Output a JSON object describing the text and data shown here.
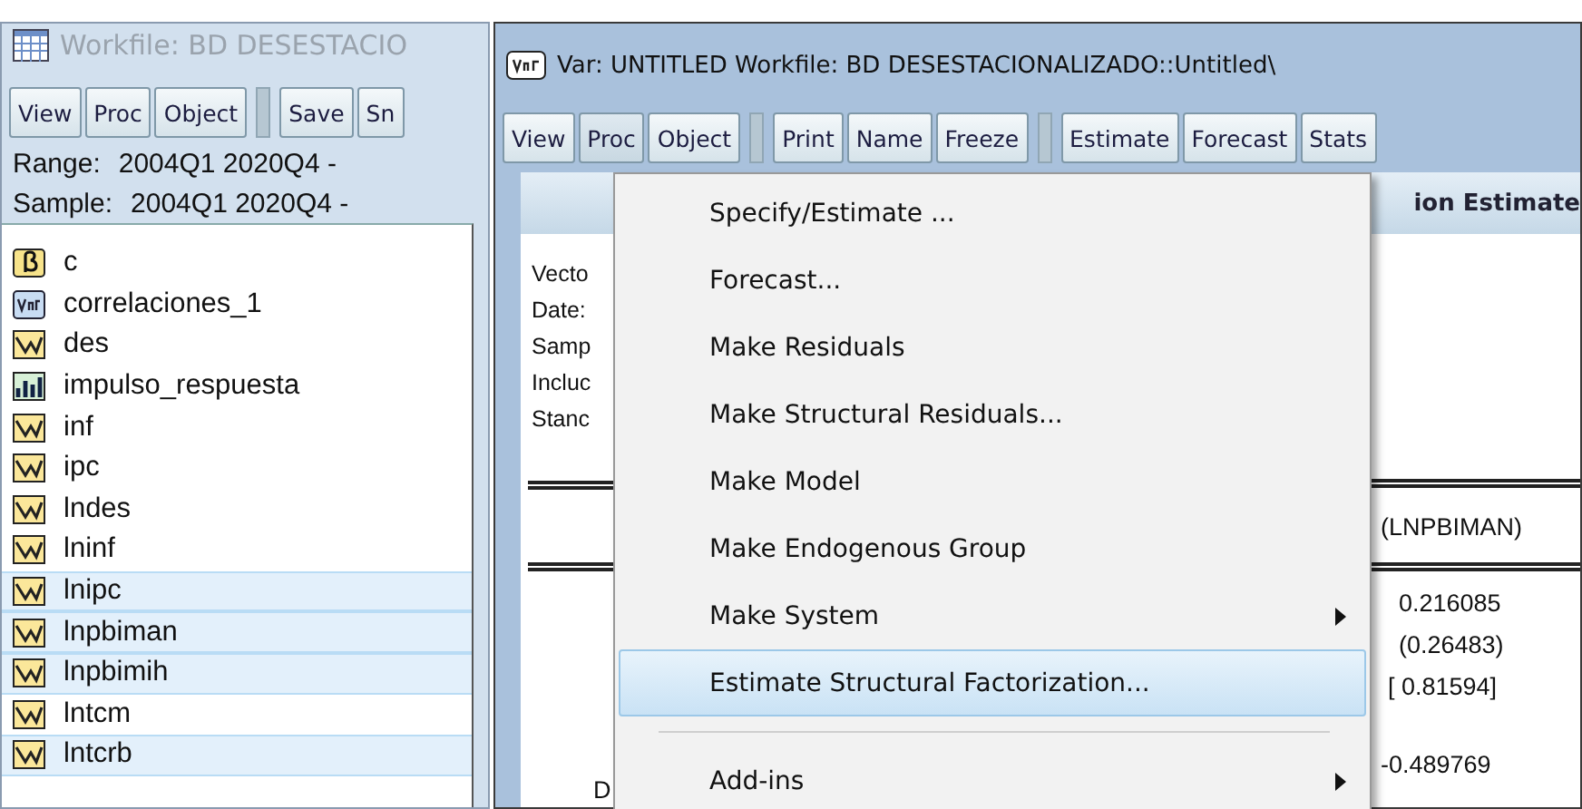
{
  "workfile_window": {
    "title": "Workfile: BD DESESTACIO",
    "active": false,
    "toolbar": [
      {
        "label": "View",
        "kind": "button"
      },
      {
        "label": "Proc",
        "kind": "button"
      },
      {
        "label": "Object",
        "kind": "button"
      },
      {
        "kind": "separator"
      },
      {
        "label": "Save",
        "kind": "button"
      },
      {
        "label": "Sn",
        "kind": "button"
      }
    ],
    "range": {
      "label": "Range:",
      "value": "2004Q1 2020Q4  -"
    },
    "sample": {
      "label": "Sample:",
      "value": "2004Q1 2020Q4  -"
    },
    "objects": [
      {
        "name": "c",
        "kind": "scalar",
        "selected": false
      },
      {
        "name": "correlaciones_1",
        "kind": "var",
        "selected": false
      },
      {
        "name": "des",
        "kind": "series",
        "selected": false
      },
      {
        "name": "impulso_respuesta",
        "kind": "graph",
        "selected": false
      },
      {
        "name": "inf",
        "kind": "series",
        "selected": false
      },
      {
        "name": "ipc",
        "kind": "series",
        "selected": false
      },
      {
        "name": "lndes",
        "kind": "series",
        "selected": false
      },
      {
        "name": "lninf",
        "kind": "series",
        "selected": false
      },
      {
        "name": "lnipc",
        "kind": "series",
        "selected": true
      },
      {
        "name": "lnpbiman",
        "kind": "series",
        "selected": true
      },
      {
        "name": "lnpbimih",
        "kind": "series",
        "selected": true
      },
      {
        "name": "lntcm",
        "kind": "series",
        "selected": false
      },
      {
        "name": "lntcrb",
        "kind": "series",
        "selected": true
      }
    ]
  },
  "var_window": {
    "title": "Var: UNTITLED   Workfile: BD DESESTACIONALIZADO::Untitled\\",
    "active": true,
    "toolbar": [
      {
        "label": "View",
        "kind": "button"
      },
      {
        "label": "Proc",
        "kind": "button",
        "pressed": true
      },
      {
        "label": "Object",
        "kind": "button"
      },
      {
        "kind": "separator"
      },
      {
        "label": "Print",
        "kind": "button"
      },
      {
        "label": "Name",
        "kind": "button"
      },
      {
        "label": "Freeze",
        "kind": "button"
      },
      {
        "kind": "separator"
      },
      {
        "label": "Estimate",
        "kind": "button"
      },
      {
        "label": "Forecast",
        "kind": "button"
      },
      {
        "label": "Stats",
        "kind": "button"
      }
    ],
    "header": "ion Estimate",
    "info_lines": [
      "Vecto",
      "Date:",
      "Samp",
      "Incluc",
      "Stanc"
    ],
    "column_heading": "(LNPBIMAN)",
    "values": [
      "0.216085",
      "(0.26483)",
      "[ 0.81594]"
    ],
    "row_label": "D",
    "last_value": "-0.489769"
  },
  "proc_menu": [
    {
      "kind": "item",
      "label": "Specify/Estimate ...",
      "submenu": false,
      "selected": false
    },
    {
      "kind": "item",
      "label": "Forecast...",
      "submenu": false,
      "selected": false
    },
    {
      "kind": "item",
      "label": "Make Residuals",
      "submenu": false,
      "selected": false
    },
    {
      "kind": "item",
      "label": "Make Structural Residuals...",
      "submenu": false,
      "selected": false
    },
    {
      "kind": "item",
      "label": "Make Model",
      "submenu": false,
      "selected": false
    },
    {
      "kind": "item",
      "label": "Make Endogenous Group",
      "submenu": false,
      "selected": false
    },
    {
      "kind": "item",
      "label": "Make System",
      "submenu": true,
      "selected": false
    },
    {
      "kind": "item",
      "label": "Estimate Structural Factorization...",
      "submenu": false,
      "selected": true
    },
    {
      "kind": "separator"
    },
    {
      "kind": "item",
      "label": "Add-ins",
      "submenu": true,
      "selected": false
    }
  ]
}
